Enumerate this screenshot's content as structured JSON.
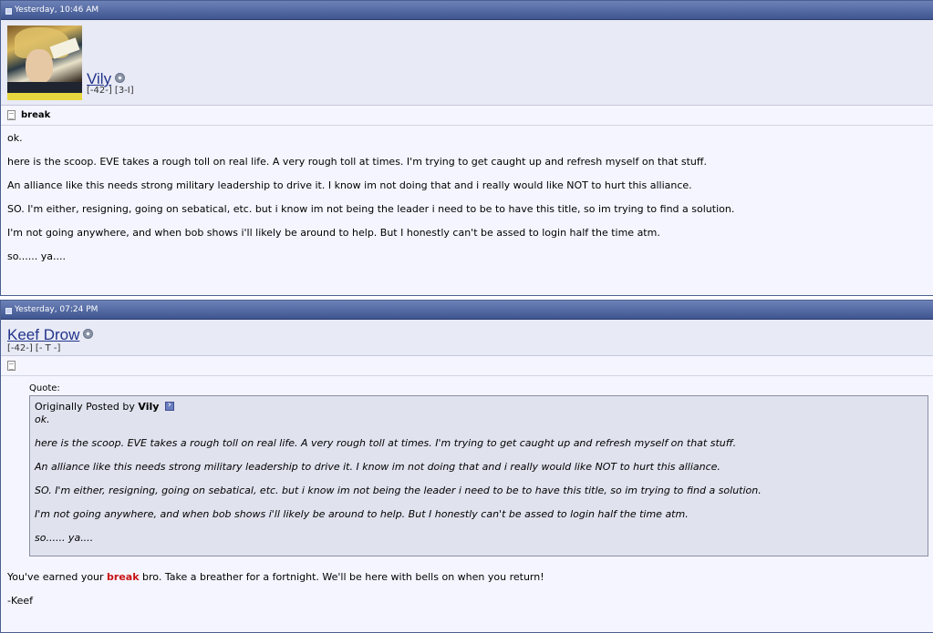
{
  "post1": {
    "timestamp": "Yesterday, 10:46 AM",
    "username": "Vily",
    "usertitle": "[-42-] [3-I]",
    "title": "break",
    "lines": [
      "ok.",
      "here is the scoop. EVE takes a rough toll on real life. A very rough toll at times. I'm trying to get caught up and refresh myself on that stuff.",
      "An alliance like this needs strong military leadership to drive it. I know im not doing that and i really would like NOT to hurt this alliance.",
      "SO. I'm either, resigning, going on sebatical, etc. but i know im not being the leader i need to be to have this title, so im trying to find a solution.",
      "I'm not going anywhere, and when bob shows i'll likely be around to help. But I honestly can't be assed to login half the time atm.",
      "so...... ya...."
    ]
  },
  "post2": {
    "timestamp": "Yesterday, 07:24 PM",
    "username": "Keef Drow",
    "usertitle": "[-42-] [- T -]",
    "quote_label": "Quote:",
    "quote_by_prefix": "Originally Posted by",
    "quote_author": "Vily",
    "quote_lines": [
      "ok.",
      "here is the scoop. EVE takes a rough toll on real life. A very rough toll at times. I'm trying to get caught up and refresh myself on that stuff.",
      "An alliance like this needs strong military leadership to drive it. I know im not doing that and i really would like NOT to hurt this alliance.",
      "SO. I'm either, resigning, going on sebatical, etc. but i know im not being the leader i need to be to have this title, so im trying to find a solution.",
      "I'm not going anywhere, and when bob shows i'll likely be around to help. But I honestly can't be assed to login half the time atm.",
      "so...... ya...."
    ],
    "reply_before": "You've earned your ",
    "reply_highlight": "break",
    "reply_after": " bro. Take a breather for a fortnight. We'll be here with bells on when you return!",
    "signoff": "-Keef"
  },
  "colors": {
    "header_bar": "#3f5590",
    "highlight": "#c81414",
    "username_link": "#22348a"
  }
}
